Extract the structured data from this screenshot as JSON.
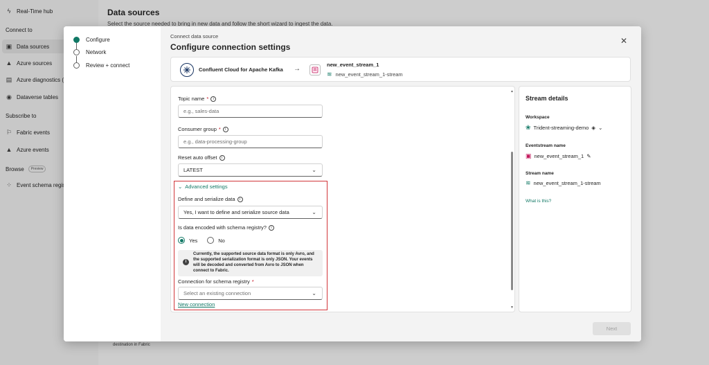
{
  "background": {
    "hub_title": "Real-Time hub",
    "sections": {
      "connect_to": "Connect to",
      "subscribe_to": "Subscribe to",
      "browse": "Browse",
      "preview_badge": "Preview"
    },
    "items": {
      "data_sources": "Data sources",
      "azure_sources": "Azure sources",
      "azure_diagnostics": "Azure diagnostics (",
      "dataverse_tables": "Dataverse tables",
      "fabric_events": "Fabric events",
      "azure_events": "Azure events",
      "event_schema": "Event schema regis"
    },
    "page_title": "Data sources",
    "page_desc": "Select the source needed to bring in new data and follow the short wizard to ingest the data.",
    "card_text": "destination in Fabric"
  },
  "wizard": {
    "steps": [
      "Configure",
      "Network",
      "Review + connect"
    ],
    "active_step": "Configure"
  },
  "dialog": {
    "subtitle": "Connect data source",
    "title": "Configure connection settings",
    "close_icon": "close-icon"
  },
  "source_bar": {
    "source_name": "Confluent Cloud for Apache Kafka",
    "arrow": "→",
    "eventstream_name": "new_event_stream_1",
    "stream_name": "new_event_stream_1-stream"
  },
  "form": {
    "topic_label": "Topic name",
    "topic_placeholder": "e.g., sales-data",
    "topic_value": "",
    "consumer_label": "Consumer group",
    "consumer_placeholder": "e.g., data-processing-group",
    "consumer_value": "",
    "reset_label": "Reset auto offset",
    "reset_value": "LATEST",
    "advanced_label": "Advanced settings",
    "define_label": "Define and serialize data",
    "define_value": "Yes, I want to define and serialize source data",
    "encoded_label": "Is data encoded with schema registry?",
    "radio_yes": "Yes",
    "radio_no": "No",
    "radio_selected": "Yes",
    "notice": "Currently, the supported source data format is only Avro, and the supported serialization format is only JSON. Your events will be decoded and converted from Avro to JSON when connect to Fabric.",
    "registry_label": "Connection for schema registry",
    "registry_placeholder": "Select an existing connection",
    "new_connection": "New connection",
    "required_mark": "*"
  },
  "details": {
    "title": "Stream details",
    "workspace_label": "Workspace",
    "workspace_value": "Trident-streaming-demo",
    "eventstream_label": "Eventstream name",
    "eventstream_value": "new_event_stream_1",
    "stream_label": "Stream name",
    "stream_value": "new_event_stream_1-stream",
    "link": "What is this?"
  },
  "footer": {
    "next": "Next"
  },
  "colors": {
    "accent": "#117865",
    "error_outline": "#d13438",
    "required": "#c50f1f"
  }
}
